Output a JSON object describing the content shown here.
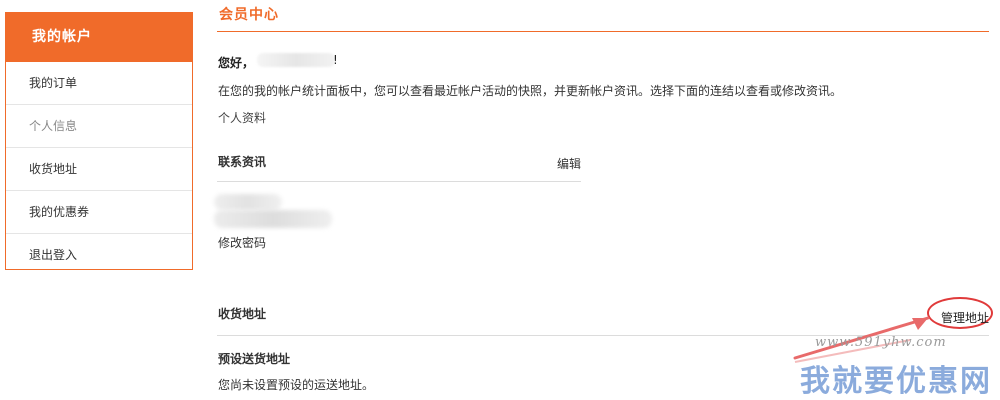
{
  "sidebar": {
    "header": "我的帐户",
    "items": [
      {
        "label": "我的订单"
      },
      {
        "label": "个人信息"
      },
      {
        "label": "收货地址"
      },
      {
        "label": "我的优惠券"
      },
      {
        "label": "退出登入"
      }
    ]
  },
  "main": {
    "title": "会员中心",
    "greeting": "您好，",
    "greeting_tail": "!",
    "intro": "在您的我的帐户统计面板中，您可以查看最近帐户活动的快照，并更新帐户资讯。选择下面的连结以查看或修改资讯。",
    "profile_label": "个人资料",
    "contact": {
      "title": "联系资讯",
      "edit": "编辑",
      "change_password": "修改密码"
    },
    "address": {
      "title": "收货地址",
      "manage": "管理地址",
      "default_title": "预设送货地址",
      "default_text": "您尚未设置预设的运送地址。"
    }
  },
  "watermark": {
    "url": "www.591yhw.com",
    "brand": "我就要优惠网"
  },
  "colors": {
    "accent": "#f06b2a",
    "highlight_circle": "#e03a3a"
  }
}
